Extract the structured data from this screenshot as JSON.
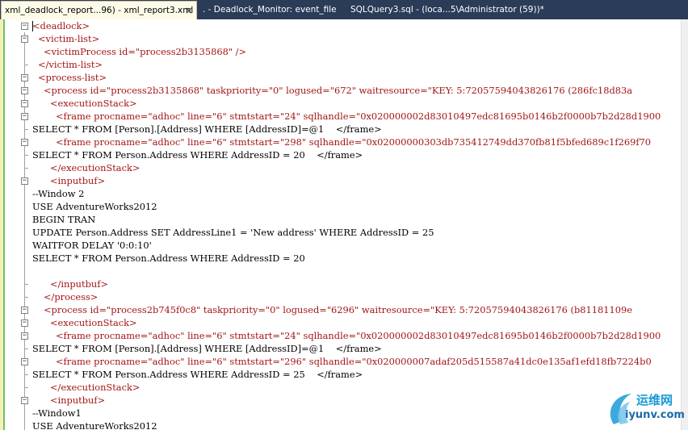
{
  "tabs": [
    {
      "label": "xml_deadlock_report...96) - xml_report3.xml",
      "active": true,
      "close": "×"
    },
    {
      "label": ". - Deadlock_Monitor: event_file",
      "active": false
    },
    {
      "label": "SQLQuery3.sql - (loca...5\\Administrator (59))*",
      "active": false
    }
  ],
  "colors": {
    "xml_markup": "#a31515",
    "plain_text": "#000000",
    "tab_bar": "#2b3c59"
  },
  "lines": [
    {
      "text": "<deadlock>",
      "indent": 40,
      "xml": true,
      "fold": "minus"
    },
    {
      "text": "<victim-list>",
      "indent": 47,
      "xml": true,
      "fold": "minus"
    },
    {
      "text": "<victimProcess id=\"process2b3135868\" />",
      "indent": 54,
      "xml": true,
      "fold": ""
    },
    {
      "text": "</victim-list>",
      "indent": 47,
      "xml": true,
      "fold": "end"
    },
    {
      "text": "<process-list>",
      "indent": 47,
      "xml": true,
      "fold": "minus"
    },
    {
      "text": "<process id=\"process2b3135868\" taskpriority=\"0\" logused=\"672\" waitresource=\"KEY: 5:72057594043826176 (286fc18d83a",
      "indent": 54,
      "xml": true,
      "fold": "minus"
    },
    {
      "text": "<executionStack>",
      "indent": 62,
      "xml": true,
      "fold": "minus"
    },
    {
      "text": "<frame procname=\"adhoc\" line=\"6\" stmtstart=\"24\" sqlhandle=\"0x020000002d83010497edc81695b0146b2f0000b7b2d28d1900",
      "indent": 69,
      "xml": true,
      "fold": "minus"
    },
    {
      "text": "SELECT * FROM [Person].[Address] WHERE [AddressID]=@1    </frame>",
      "indent": 40,
      "xml": false,
      "fold": "end"
    },
    {
      "text": "<frame procname=\"adhoc\" line=\"6\" stmtstart=\"298\" sqlhandle=\"0x02000000303db735412749dd370fb81f5bfed689c1f269f70",
      "indent": 69,
      "xml": true,
      "fold": "minus"
    },
    {
      "text": "SELECT * FROM Person.Address WHERE AddressID = 20    </frame>",
      "indent": 40,
      "xml": false,
      "fold": "end"
    },
    {
      "text": "</executionStack>",
      "indent": 62,
      "xml": true,
      "fold": "end"
    },
    {
      "text": "<inputbuf>",
      "indent": 62,
      "xml": true,
      "fold": "minus"
    },
    {
      "text": "--Window 2",
      "indent": 40,
      "xml": false,
      "fold": ""
    },
    {
      "text": "USE AdventureWorks2012",
      "indent": 40,
      "xml": false,
      "fold": ""
    },
    {
      "text": "BEGIN TRAN",
      "indent": 40,
      "xml": false,
      "fold": ""
    },
    {
      "text": "UPDATE Person.Address SET AddressLine1 = 'New address' WHERE AddressID = 25",
      "indent": 40,
      "xml": false,
      "fold": ""
    },
    {
      "text": "WAITFOR DELAY '0:0:10'",
      "indent": 40,
      "xml": false,
      "fold": ""
    },
    {
      "text": "SELECT * FROM Person.Address WHERE AddressID = 20",
      "indent": 40,
      "xml": false,
      "fold": ""
    },
    {
      "text": "",
      "indent": 40,
      "xml": false,
      "fold": ""
    },
    {
      "text": "</inputbuf>",
      "indent": 62,
      "xml": true,
      "fold": "end"
    },
    {
      "text": "</process>",
      "indent": 54,
      "xml": true,
      "fold": "end"
    },
    {
      "text": "<process id=\"process2b745f0c8\" taskpriority=\"0\" logused=\"6296\" waitresource=\"KEY: 5:72057594043826176 (b81181109e",
      "indent": 54,
      "xml": true,
      "fold": "minus"
    },
    {
      "text": "<executionStack>",
      "indent": 62,
      "xml": true,
      "fold": "minus"
    },
    {
      "text": "<frame procname=\"adhoc\" line=\"6\" stmtstart=\"24\" sqlhandle=\"0x020000002d83010497edc81695b0146b2f0000b7b2d28d1900",
      "indent": 69,
      "xml": true,
      "fold": "minus"
    },
    {
      "text": "SELECT * FROM [Person].[Address] WHERE [AddressID]=@1    </frame>",
      "indent": 40,
      "xml": false,
      "fold": "end"
    },
    {
      "text": "<frame procname=\"adhoc\" line=\"6\" stmtstart=\"296\" sqlhandle=\"0x020000007adaf205d515587a41dc0e135af1efd18fb7224b0",
      "indent": 69,
      "xml": true,
      "fold": "minus"
    },
    {
      "text": "SELECT * FROM Person.Address WHERE AddressID = 25    </frame>",
      "indent": 40,
      "xml": false,
      "fold": "end"
    },
    {
      "text": "</executionStack>",
      "indent": 62,
      "xml": true,
      "fold": "end"
    },
    {
      "text": "<inputbuf>",
      "indent": 62,
      "xml": true,
      "fold": "minus"
    },
    {
      "text": "--Window1",
      "indent": 40,
      "xml": false,
      "fold": ""
    },
    {
      "text": "USE AdventureWorks2012",
      "indent": 40,
      "xml": false,
      "fold": ""
    }
  ],
  "watermark": {
    "top": "运维网",
    "bottom": "iyunv.com"
  }
}
